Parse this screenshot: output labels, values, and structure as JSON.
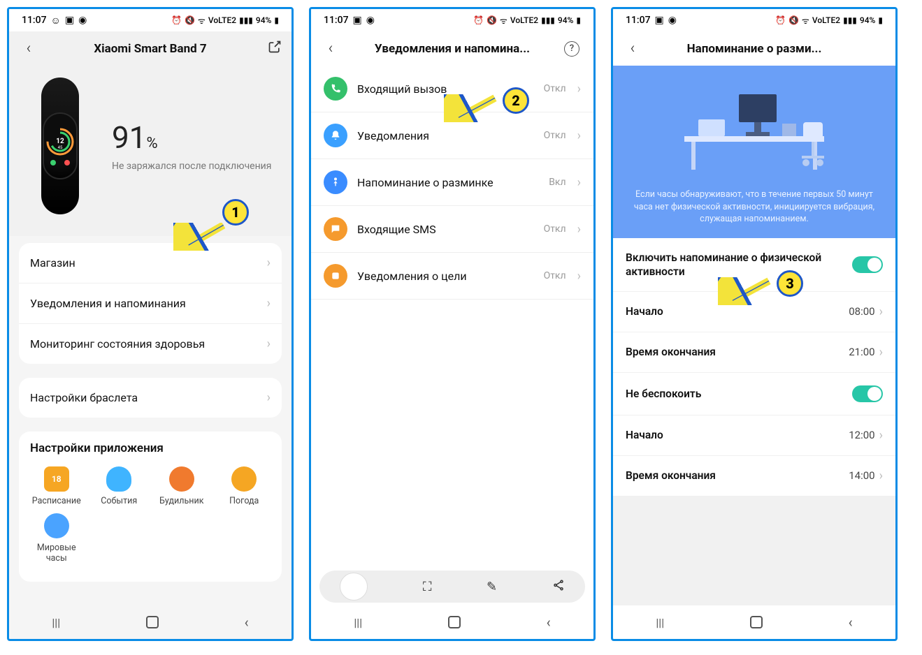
{
  "status": {
    "time": "11:07",
    "battery": "94%",
    "net_label": "VoLTE2"
  },
  "screen1": {
    "title": "Xiaomi Smart Band 7",
    "battery_pct": "91",
    "battery_unit": "%",
    "battery_sub": "Не заряжался после подключения",
    "rows": [
      {
        "label": "Магазин"
      },
      {
        "label": "Уведомления и напоминания"
      },
      {
        "label": "Мониторинг состояния здоровья"
      }
    ],
    "row_band": {
      "label": "Настройки браслета"
    },
    "app_section": "Настройки приложения",
    "apps": [
      {
        "label": "Расписание",
        "color": "#f6a623",
        "badge": "18"
      },
      {
        "label": "События",
        "color": "#3fb4ff",
        "badge": ""
      },
      {
        "label": "Будильник",
        "color": "#f07a2e",
        "badge": ""
      },
      {
        "label": "Погода",
        "color": "#f5a623",
        "badge": ""
      },
      {
        "label": "Мировые часы",
        "color": "#4aa3ff",
        "badge": ""
      }
    ]
  },
  "screen2": {
    "title": "Уведомления и напомина...",
    "items": [
      {
        "label": "Входящий вызов",
        "value": "Откл",
        "bg": "#34c06b",
        "icon": "phone-icon"
      },
      {
        "label": "Уведомления",
        "value": "Откл",
        "bg": "#3aa0ff",
        "icon": "bell-icon"
      },
      {
        "label": "Напоминание о разминке",
        "value": "Вкл",
        "bg": "#3a8cff",
        "icon": "person-icon"
      },
      {
        "label": "Входящие SMS",
        "value": "Откл",
        "bg": "#f59a2d",
        "icon": "sms-icon"
      },
      {
        "label": "Уведомления о цели",
        "value": "Откл",
        "bg": "#f59a2d",
        "icon": "goal-icon"
      }
    ]
  },
  "screen3": {
    "title": "Напоминание о разми...",
    "hero_text": "Если часы обнаруживают, что в течение первых 50 минут часа нет физической активности, инициируется вибрация, служащая напоминанием.",
    "rows": [
      {
        "label": "Включить напоминание о физической активности",
        "type": "toggle",
        "on": true
      },
      {
        "label": "Начало",
        "value": "08:00",
        "type": "link"
      },
      {
        "label": "Время окончания",
        "value": "21:00",
        "type": "link"
      },
      {
        "label": "Не беспокоить",
        "type": "toggle",
        "on": true
      },
      {
        "label": "Начало",
        "value": "12:00",
        "type": "link"
      },
      {
        "label": "Время окончания",
        "value": "14:00",
        "type": "link"
      }
    ]
  },
  "callouts": {
    "c1": "1",
    "c2": "2",
    "c3": "3"
  }
}
